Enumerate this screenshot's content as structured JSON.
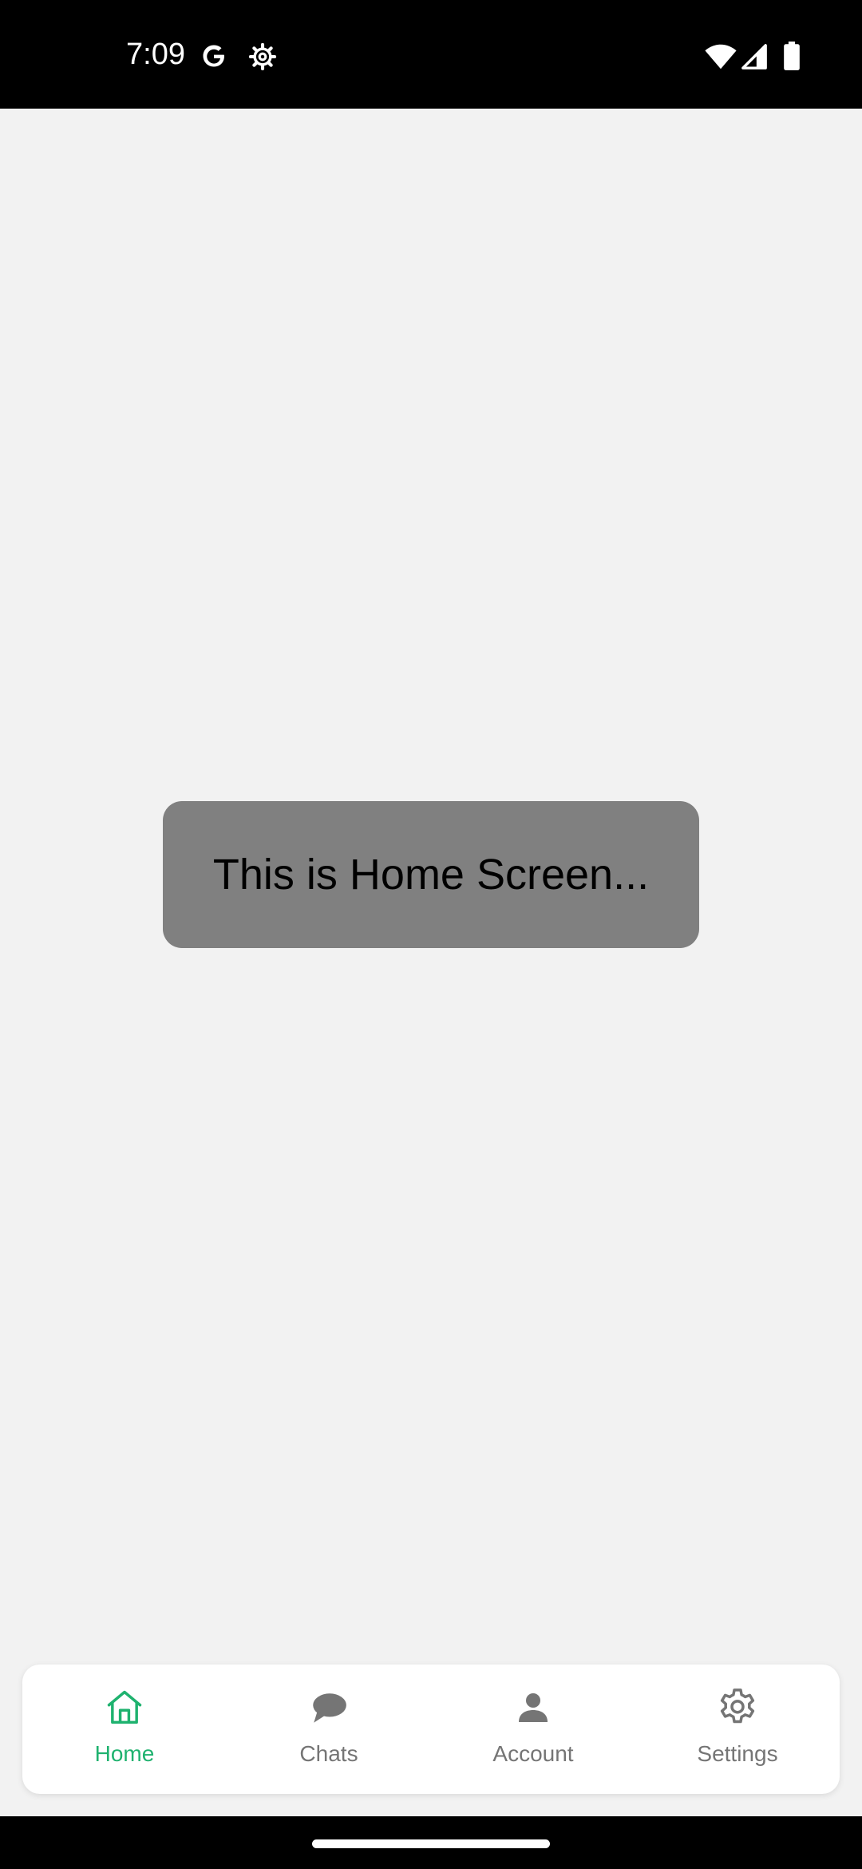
{
  "status_bar": {
    "time": "7:09",
    "icons": [
      "google-g-icon",
      "settings-cog-icon",
      "wifi-icon",
      "cell-signal-icon",
      "battery-icon"
    ]
  },
  "main": {
    "message": "This is Home Screen..."
  },
  "bottom_nav": {
    "active_color": "#1fb26f",
    "inactive_color": "#757575",
    "items": [
      {
        "label": "Home",
        "icon": "home-icon",
        "active": true
      },
      {
        "label": "Chats",
        "icon": "chat-bubble-icon",
        "active": false
      },
      {
        "label": "Account",
        "icon": "person-icon",
        "active": false
      },
      {
        "label": "Settings",
        "icon": "gear-icon",
        "active": false
      }
    ]
  }
}
